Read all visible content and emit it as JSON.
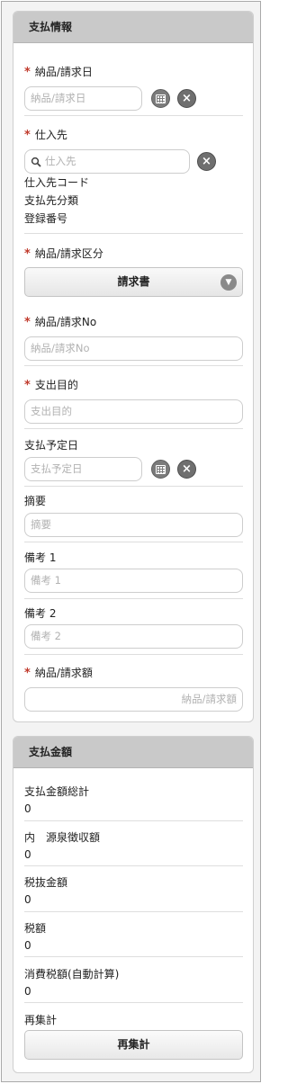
{
  "payment_info": {
    "header": "支払情報",
    "invoice_date": {
      "label": "納品/請求日",
      "placeholder": "納品/請求日",
      "required": true
    },
    "supplier": {
      "label": "仕入先",
      "placeholder": "仕入先",
      "required": true,
      "sub_lines": [
        "仕入先コード",
        "支払先分類",
        "登録番号"
      ]
    },
    "invoice_type": {
      "label": "納品/請求区分",
      "value": "請求書",
      "required": true
    },
    "invoice_no": {
      "label": "納品/請求No",
      "placeholder": "納品/請求No",
      "required": true
    },
    "purpose": {
      "label": "支出目的",
      "placeholder": "支出目的",
      "required": true
    },
    "scheduled_date": {
      "label": "支払予定日",
      "placeholder": "支払予定日"
    },
    "summary": {
      "label": "摘要",
      "placeholder": "摘要"
    },
    "note1": {
      "label": "備考 1",
      "placeholder": "備考 1"
    },
    "note2": {
      "label": "備考 2",
      "placeholder": "備考 2"
    },
    "invoice_amount": {
      "label": "納品/請求額",
      "placeholder": "納品/請求額",
      "required": true
    }
  },
  "payment_amount": {
    "header": "支払金額",
    "rows": [
      {
        "label": "支払金額総計",
        "value": "0"
      },
      {
        "label": "内　源泉徴収額",
        "value": "0"
      },
      {
        "label": "税抜金額",
        "value": "0"
      },
      {
        "label": "税額",
        "value": "0"
      },
      {
        "label": "消費税額(自動計算)",
        "value": "0"
      }
    ],
    "recalc_label": "再集計",
    "recalc_button": "再集計"
  },
  "icons": {
    "calendar": "calendar-icon",
    "clear": "clear-icon",
    "search": "search-icon",
    "chevron": "chevron-down-icon"
  }
}
